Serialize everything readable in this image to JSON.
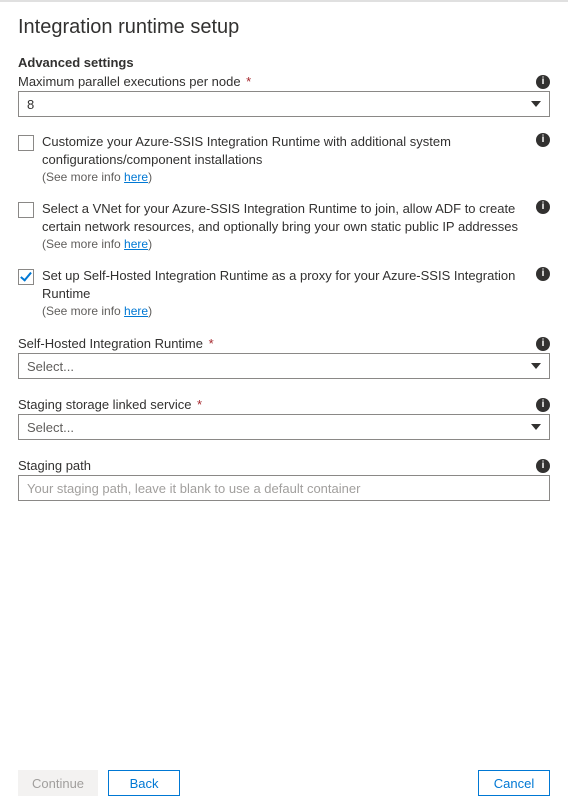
{
  "title": "Integration runtime setup",
  "section_heading": "Advanced settings",
  "max_parallel": {
    "label": "Maximum parallel executions per node",
    "value": "8"
  },
  "checkboxes": {
    "customize": {
      "label": "Customize your Azure-SSIS Integration Runtime with additional system configurations/component installations",
      "see_more_prefix": "(See more info ",
      "see_more_link": "here",
      "see_more_suffix": ")"
    },
    "vnet": {
      "label": "Select a VNet for your Azure-SSIS Integration Runtime to join, allow ADF to create certain network resources, and optionally bring your own static public IP addresses",
      "see_more_prefix": "(See more info ",
      "see_more_link": "here",
      "see_more_suffix": ")"
    },
    "proxy": {
      "label": "Set up Self-Hosted Integration Runtime as a proxy for your Azure-SSIS Integration Runtime",
      "see_more_prefix": "(See more info ",
      "see_more_link": "here",
      "see_more_suffix": ")"
    }
  },
  "shir": {
    "label": "Self-Hosted Integration Runtime",
    "placeholder": "Select..."
  },
  "staging_service": {
    "label": "Staging storage linked service",
    "placeholder": "Select..."
  },
  "staging_path": {
    "label": "Staging path",
    "placeholder": "Your staging path, leave it blank to use a default container"
  },
  "footer": {
    "continue": "Continue",
    "back": "Back",
    "cancel": "Cancel"
  }
}
